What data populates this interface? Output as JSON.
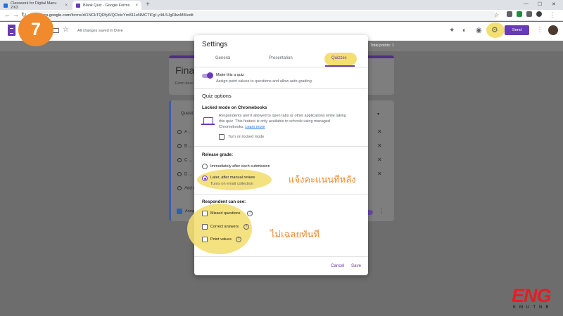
{
  "browser": {
    "tabs": [
      {
        "label": "Classwork for Digital Manu 2/63",
        "color": "#1a73e8"
      },
      {
        "label": "Blank Quiz - Google Forms",
        "color": "#673ab7"
      }
    ],
    "tab_close": "×",
    "new_tab": "+",
    "url_host": "docs.google.com",
    "url_path": "/forms/d/1NCkTQRfy6/QOoicYm811eNMCTiFg/-y4tL5JgRkwM8/edit",
    "window_controls": [
      "—",
      "☐",
      "✕"
    ]
  },
  "header": {
    "saved_status": "All changes saved in Drive",
    "send_label": "Send"
  },
  "step_number": "7",
  "canvas": {
    "total_points": "Total points: 1",
    "form_title": "Final",
    "form_desc": "Form desc",
    "question_label": "Questi",
    "options": [
      "A ...",
      "B ...",
      "C ...",
      "D ..."
    ],
    "add_option": "Add o",
    "answer_key": "Answ"
  },
  "dialog": {
    "title": "Settings",
    "tabs": [
      "General",
      "Presentation",
      "Quizzes"
    ],
    "quiz_toggle_label": "Make this a quiz",
    "quiz_toggle_desc": "Assign point values to questions and allow auto-grading.",
    "quiz_options_heading": "Quiz options",
    "locked_mode_heading": "Locked mode on Chromebooks",
    "locked_mode_desc_1": "Respondents aren't allowed to open tabs or other applications while taking",
    "locked_mode_desc_2": "this quiz. This feature is only available to schools using managed",
    "locked_mode_desc_3": "Chromebooks.",
    "learn_more": "Learn more",
    "locked_mode_checkbox": "Turn on locked mode",
    "release_heading": "Release grade:",
    "release_immediate": "Immediately after each submission",
    "release_later": "Later, after manual review",
    "release_later_desc": "Turns on email collection",
    "respondent_heading": "Respondent can see:",
    "see_missed": "Missed questions",
    "see_correct": "Correct answers",
    "see_points": "Point values",
    "cancel_label": "Cancel",
    "save_label": "Save"
  },
  "annotations": {
    "release_note": "แจ้งคะแนนทีหลัง",
    "respondent_note": "ไม่เฉลยทันที"
  },
  "logo": {
    "main": "ENG",
    "sub": "KMUTNB"
  }
}
